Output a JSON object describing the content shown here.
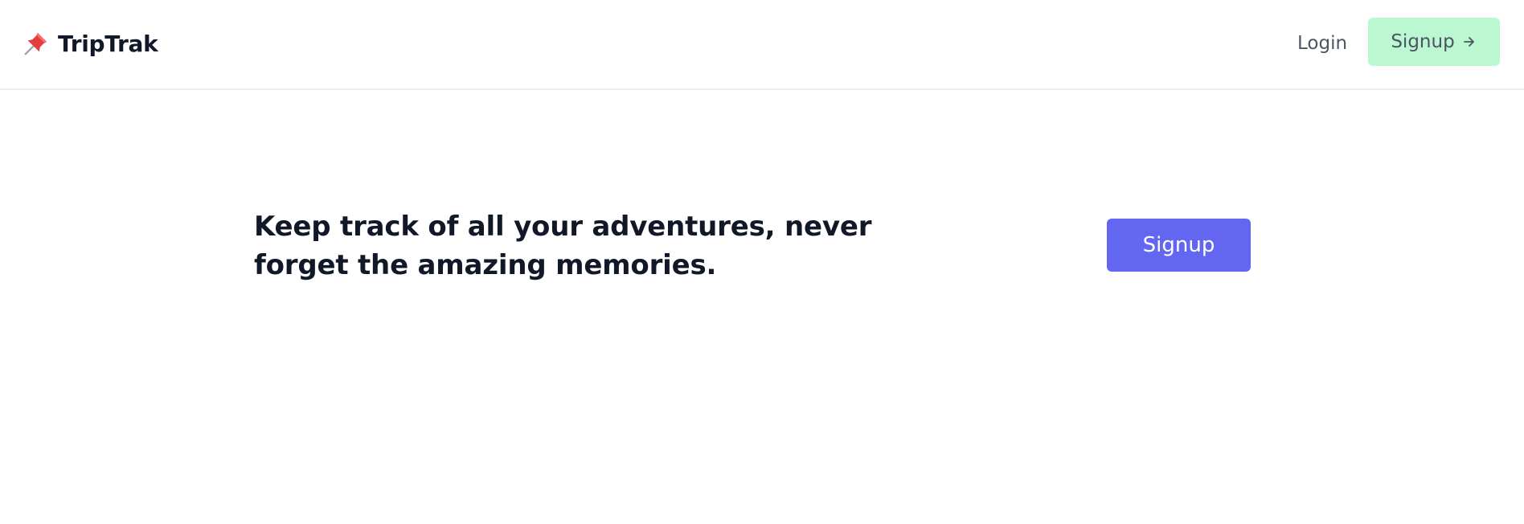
{
  "header": {
    "brand": {
      "icon": "pushpin-icon",
      "name": "TripTrak"
    },
    "nav": {
      "login_label": "Login",
      "signup_label": "Signup",
      "signup_icon": "arrow-right-icon"
    }
  },
  "hero": {
    "tagline": "Keep track of all your adventures, never forget the amazing memories.",
    "cta_label": "Signup"
  },
  "colors": {
    "accent": "#6366f1",
    "signup_top_bg": "#bbf7d0",
    "pin_red": "#e53e3e",
    "text_primary": "#111827",
    "text_secondary": "#4b5563"
  }
}
